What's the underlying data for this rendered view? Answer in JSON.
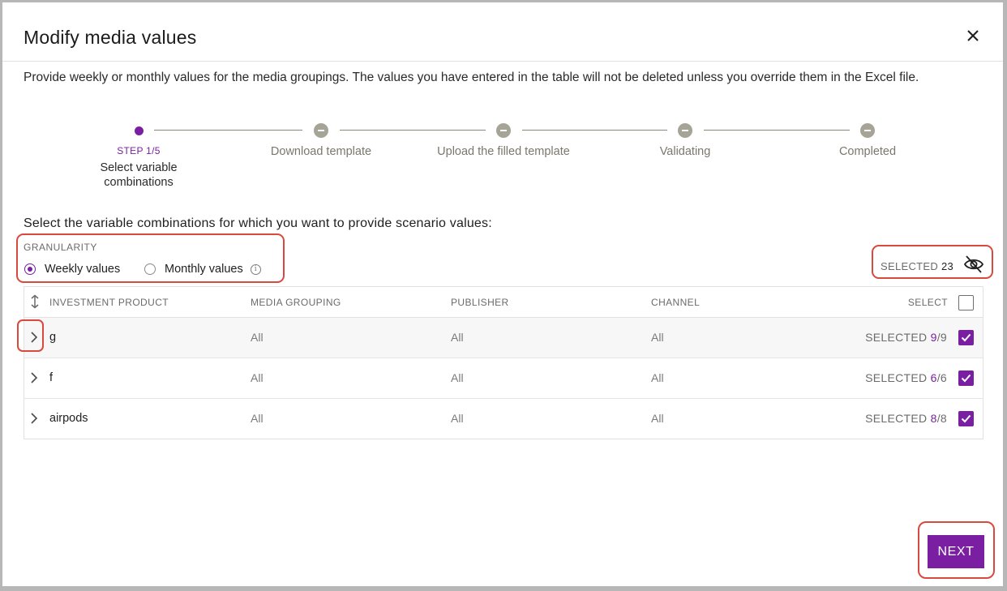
{
  "modal": {
    "title": "Modify media values",
    "description": "Provide weekly or monthly values for the media groupings. The values you have entered in the table will not be deleted unless you override them in the Excel file."
  },
  "stepper": {
    "current_step": "STEP 1/5",
    "steps": [
      {
        "label": "Select variable combinations",
        "state": "active"
      },
      {
        "label": "Download template",
        "state": "pending"
      },
      {
        "label": "Upload the filled template",
        "state": "pending"
      },
      {
        "label": "Validating",
        "state": "pending"
      },
      {
        "label": "Completed",
        "state": "pending"
      }
    ]
  },
  "section": {
    "prompt": "Select the variable combinations for which you want to provide scenario values:"
  },
  "granularity": {
    "label": "GRANULARITY",
    "options": [
      {
        "label": "Weekly values",
        "selected": true
      },
      {
        "label": "Monthly values",
        "selected": false
      }
    ],
    "info_icon": "info-icon"
  },
  "selection_summary": {
    "label": "SELECTED",
    "count": "23",
    "toggle_icon": "eye-off-icon"
  },
  "table": {
    "columns": [
      "INVESTMENT PRODUCT",
      "MEDIA GROUPING",
      "PUBLISHER",
      "CHANNEL",
      "SELECT"
    ],
    "rows": [
      {
        "product": "g",
        "media_grouping": "All",
        "publisher": "All",
        "channel": "All",
        "selected_label": "SELECTED",
        "selected": "9",
        "total": "9",
        "checked": true
      },
      {
        "product": "f",
        "media_grouping": "All",
        "publisher": "All",
        "channel": "All",
        "selected_label": "SELECTED",
        "selected": "6",
        "total": "6",
        "checked": true
      },
      {
        "product": "airpods",
        "media_grouping": "All",
        "publisher": "All",
        "channel": "All",
        "selected_label": "SELECTED",
        "selected": "8",
        "total": "8",
        "checked": true
      }
    ]
  },
  "footer": {
    "next_label": "NEXT"
  },
  "colors": {
    "accent": "#7a1fa2",
    "highlight": "#d9493d",
    "step_pending": "#a5a496"
  }
}
